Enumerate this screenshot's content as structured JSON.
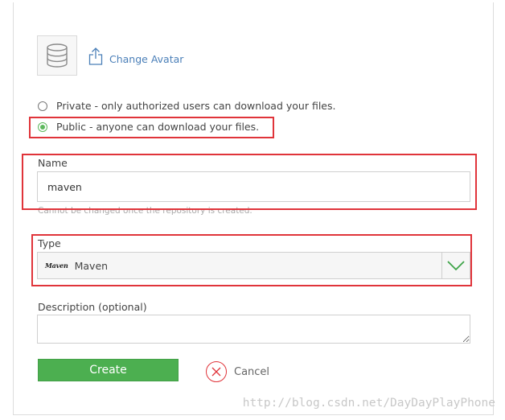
{
  "avatar": {
    "icon": "database-icon",
    "change_label": "Change Avatar",
    "upload_icon": "upload-icon"
  },
  "visibility": {
    "options": [
      {
        "label": "Private - only authorized users can download your files.",
        "checked": false
      },
      {
        "label": "Public - anyone can download your files.",
        "checked": true
      }
    ]
  },
  "name_field": {
    "label": "Name",
    "value": "maven",
    "hint": "Cannot be changed once the repository is created."
  },
  "type_field": {
    "label": "Type",
    "logo_text": "Maven",
    "selected": "Maven",
    "arrow_icon": "chevron-down-icon"
  },
  "description_field": {
    "label": "Description (optional)",
    "value": ""
  },
  "actions": {
    "create_label": "Create",
    "cancel_label": "Cancel",
    "cancel_icon": "close-icon"
  },
  "watermark": "http://blog.csdn.net/DayDayPlayPhone",
  "colors": {
    "accent_green": "#4caf50",
    "link_blue": "#4a7fb8",
    "highlight_red": "#e0343a"
  }
}
